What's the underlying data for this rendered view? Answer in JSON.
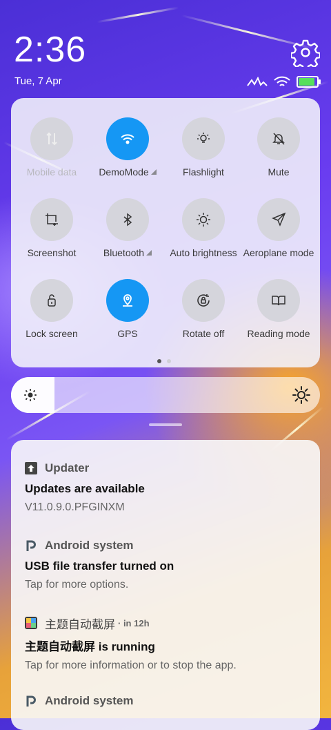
{
  "status": {
    "time": "2:36",
    "date": "Tue, 7 Apr",
    "battery_level": 0.9,
    "icons": [
      "network-speed-icon",
      "wifi-icon",
      "battery-icon"
    ]
  },
  "quick_settings": {
    "tiles": [
      {
        "label": "Mobile data",
        "icon": "mobile-data-icon",
        "state": "disabled"
      },
      {
        "label": "DemoMode",
        "icon": "wifi-icon",
        "state": "on",
        "expandable": true
      },
      {
        "label": "Flashlight",
        "icon": "flashlight-icon",
        "state": "off"
      },
      {
        "label": "Mute",
        "icon": "mute-icon",
        "state": "off"
      },
      {
        "label": "Screenshot",
        "icon": "screenshot-icon",
        "state": "off"
      },
      {
        "label": "Bluetooth",
        "icon": "bluetooth-icon",
        "state": "off",
        "expandable": true
      },
      {
        "label": "Auto brightness",
        "icon": "auto-brightness-icon",
        "state": "off"
      },
      {
        "label": "Aeroplane mode",
        "icon": "aeroplane-icon",
        "state": "off"
      },
      {
        "label": "Lock screen",
        "icon": "lock-screen-icon",
        "state": "off"
      },
      {
        "label": "GPS",
        "icon": "gps-icon",
        "state": "on"
      },
      {
        "label": "Rotate off",
        "icon": "rotate-lock-icon",
        "state": "off"
      },
      {
        "label": "Reading mode",
        "icon": "reading-mode-icon",
        "state": "off"
      }
    ],
    "pages": 2,
    "current_page": 1
  },
  "brightness": {
    "level": 0.14
  },
  "notifications": [
    {
      "app": "Updater",
      "icon": "upload-arrow-icon",
      "time": "",
      "title": "Updates are available",
      "text": "V11.0.9.0.PFGINXM"
    },
    {
      "app": "Android system",
      "icon": "android-system-icon",
      "time": "",
      "title": "USB file transfer turned on",
      "text": "Tap for more options."
    },
    {
      "app": "主题自动截屏",
      "icon": "theme-app-icon",
      "time": "· in 12h",
      "title": "主题自动截屏 is running",
      "text": "Tap for more information or to stop the app."
    },
    {
      "app": "Android system",
      "icon": "android-system-icon",
      "time": "",
      "title": "",
      "text": ""
    }
  ],
  "colors": {
    "accent": "#1597f4",
    "battery": "#56e05b"
  }
}
